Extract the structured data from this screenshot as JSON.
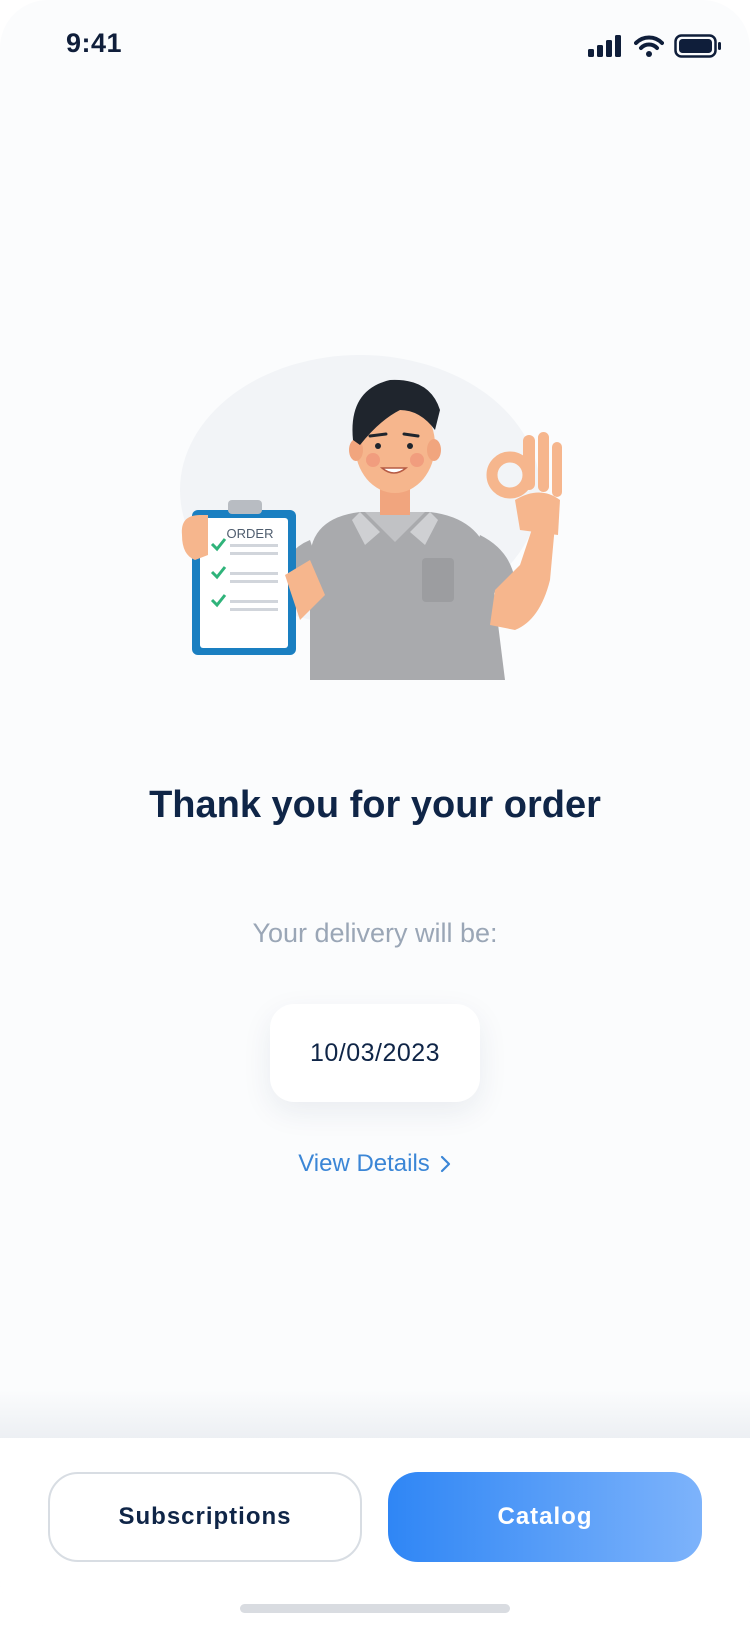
{
  "status_bar": {
    "time": "9:41"
  },
  "main": {
    "illustration": {
      "clipboard_label": "ORDER"
    },
    "title": "Thank you for your order",
    "subtitle": "Your delivery will be:",
    "delivery_date": "10/03/2023",
    "details_link": "View Details"
  },
  "footer": {
    "subscriptions_label": "Subscriptions",
    "catalog_label": "Catalog"
  },
  "colors": {
    "primary": "#2f86f5",
    "title": "#0f2547",
    "link": "#3b86d6"
  }
}
